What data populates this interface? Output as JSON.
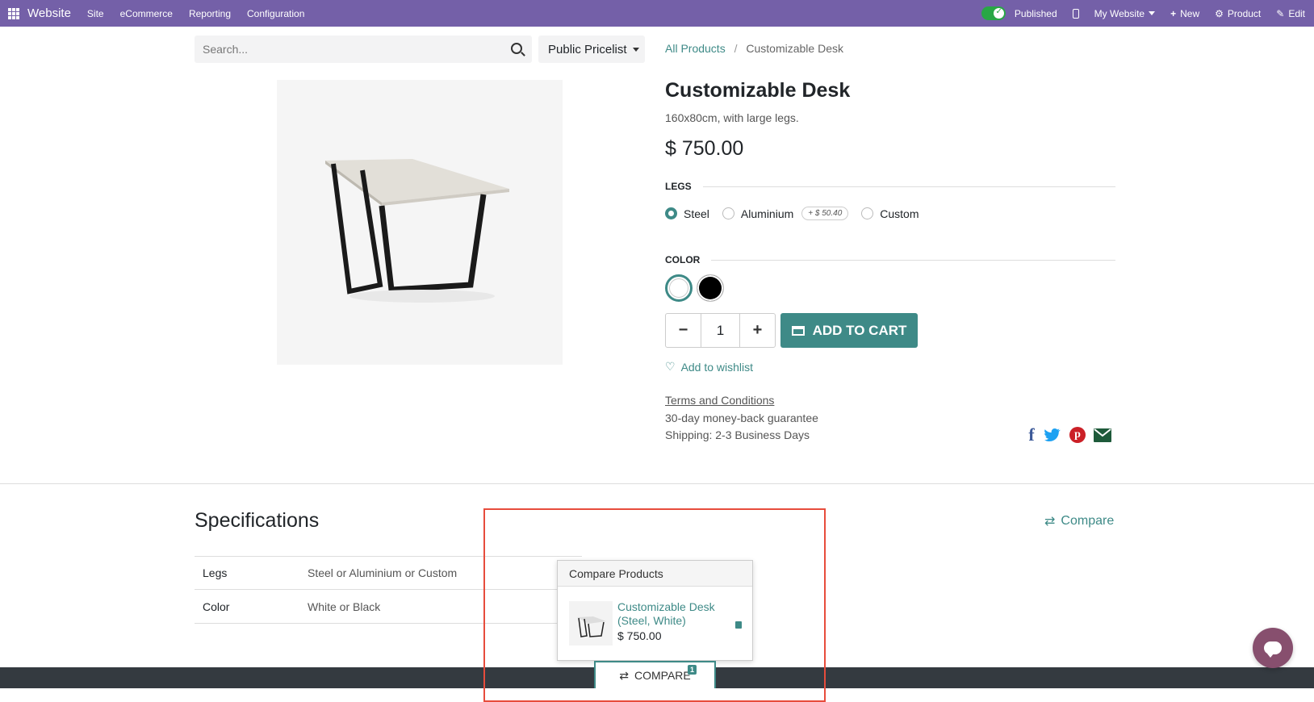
{
  "topbar": {
    "brand": "Website",
    "menus": [
      "Site",
      "eCommerce",
      "Reporting",
      "Configuration"
    ],
    "published_label": "Published",
    "website_label": "My Website",
    "new_label": "New",
    "product_label": "Product",
    "edit_label": "Edit"
  },
  "search": {
    "placeholder": "Search..."
  },
  "pricelist": {
    "label": "Public Pricelist"
  },
  "breadcrumb": {
    "root": "All Products",
    "separator": "/",
    "current": "Customizable Desk"
  },
  "product": {
    "name": "Customizable Desk",
    "description": "160x80cm, with large legs.",
    "price": "$ 750.00",
    "legs_label": "LEGS",
    "legs_options": [
      {
        "label": "Steel",
        "selected": true
      },
      {
        "label": "Aluminium",
        "extra": "+ $ 50.40"
      },
      {
        "label": "Custom"
      }
    ],
    "color_label": "COLOR",
    "colors": [
      "#ffffff",
      "#000000"
    ],
    "quantity": "1",
    "add_to_cart": "ADD TO CART",
    "wishlist": "Add to wishlist",
    "terms": "Terms and Conditions",
    "guarantee": "30-day money-back guarantee",
    "shipping": "Shipping: 2-3 Business Days"
  },
  "social": {
    "facebook": "f",
    "twitter": "t",
    "pinterest": "p",
    "email": "@"
  },
  "specs": {
    "title": "Specifications",
    "compare_label": "Compare",
    "rows": [
      {
        "key": "Legs",
        "value": "Steel or Aluminium or Custom"
      },
      {
        "key": "Color",
        "value": "White or Black"
      }
    ]
  },
  "compare_popover": {
    "header": "Compare Products",
    "item_name": "Customizable Desk (Steel, White)",
    "item_price": "$ 750.00",
    "tab_label": "COMPARE",
    "count": "1"
  },
  "colors": {
    "topbar": "#7460a8",
    "accent": "#3e8a87",
    "highlight": "#e74c3c",
    "chat": "#874f6e"
  }
}
